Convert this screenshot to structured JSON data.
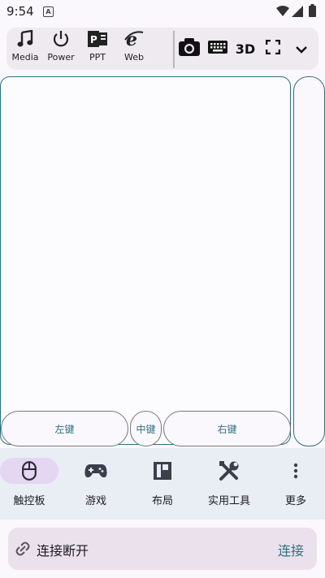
{
  "status_bar": {
    "time": "9:54",
    "app_icon_letter": "A",
    "icons": [
      "wifi-icon",
      "signal-icon",
      "battery-icon"
    ]
  },
  "toolbar": {
    "items": [
      {
        "label": "Media",
        "icon": "music-note-icon"
      },
      {
        "label": "Power",
        "icon": "power-icon"
      },
      {
        "label": "PPT",
        "icon": "ppt-icon"
      },
      {
        "label": "Web",
        "icon": "web-browser-icon"
      }
    ],
    "quick_buttons": [
      {
        "icon": "camera-icon"
      },
      {
        "icon": "keyboard-icon"
      },
      {
        "text": "3D"
      },
      {
        "icon": "fullscreen-icon"
      },
      {
        "icon": "chevron-down-icon"
      }
    ]
  },
  "touchpad": {
    "left_button": "左键",
    "middle_button": "中键",
    "right_button": "右键"
  },
  "bottom_nav": {
    "items": [
      {
        "label": "触控板",
        "icon": "mouse-icon",
        "active": true
      },
      {
        "label": "游戏",
        "icon": "gamepad-icon",
        "active": false
      },
      {
        "label": "布局",
        "icon": "layout-icon",
        "active": false
      },
      {
        "label": "实用工具",
        "icon": "tools-icon",
        "active": false
      },
      {
        "label": "更多",
        "icon": "more-vert-icon",
        "active": false
      }
    ]
  },
  "connection": {
    "status": "连接断开",
    "action": "连接"
  },
  "colors": {
    "accent": "#2f6f7e",
    "nav_active_pill": "#e4d7f2",
    "nav_background": "#e9edf4",
    "connection_bar": "#ebe1ec"
  }
}
